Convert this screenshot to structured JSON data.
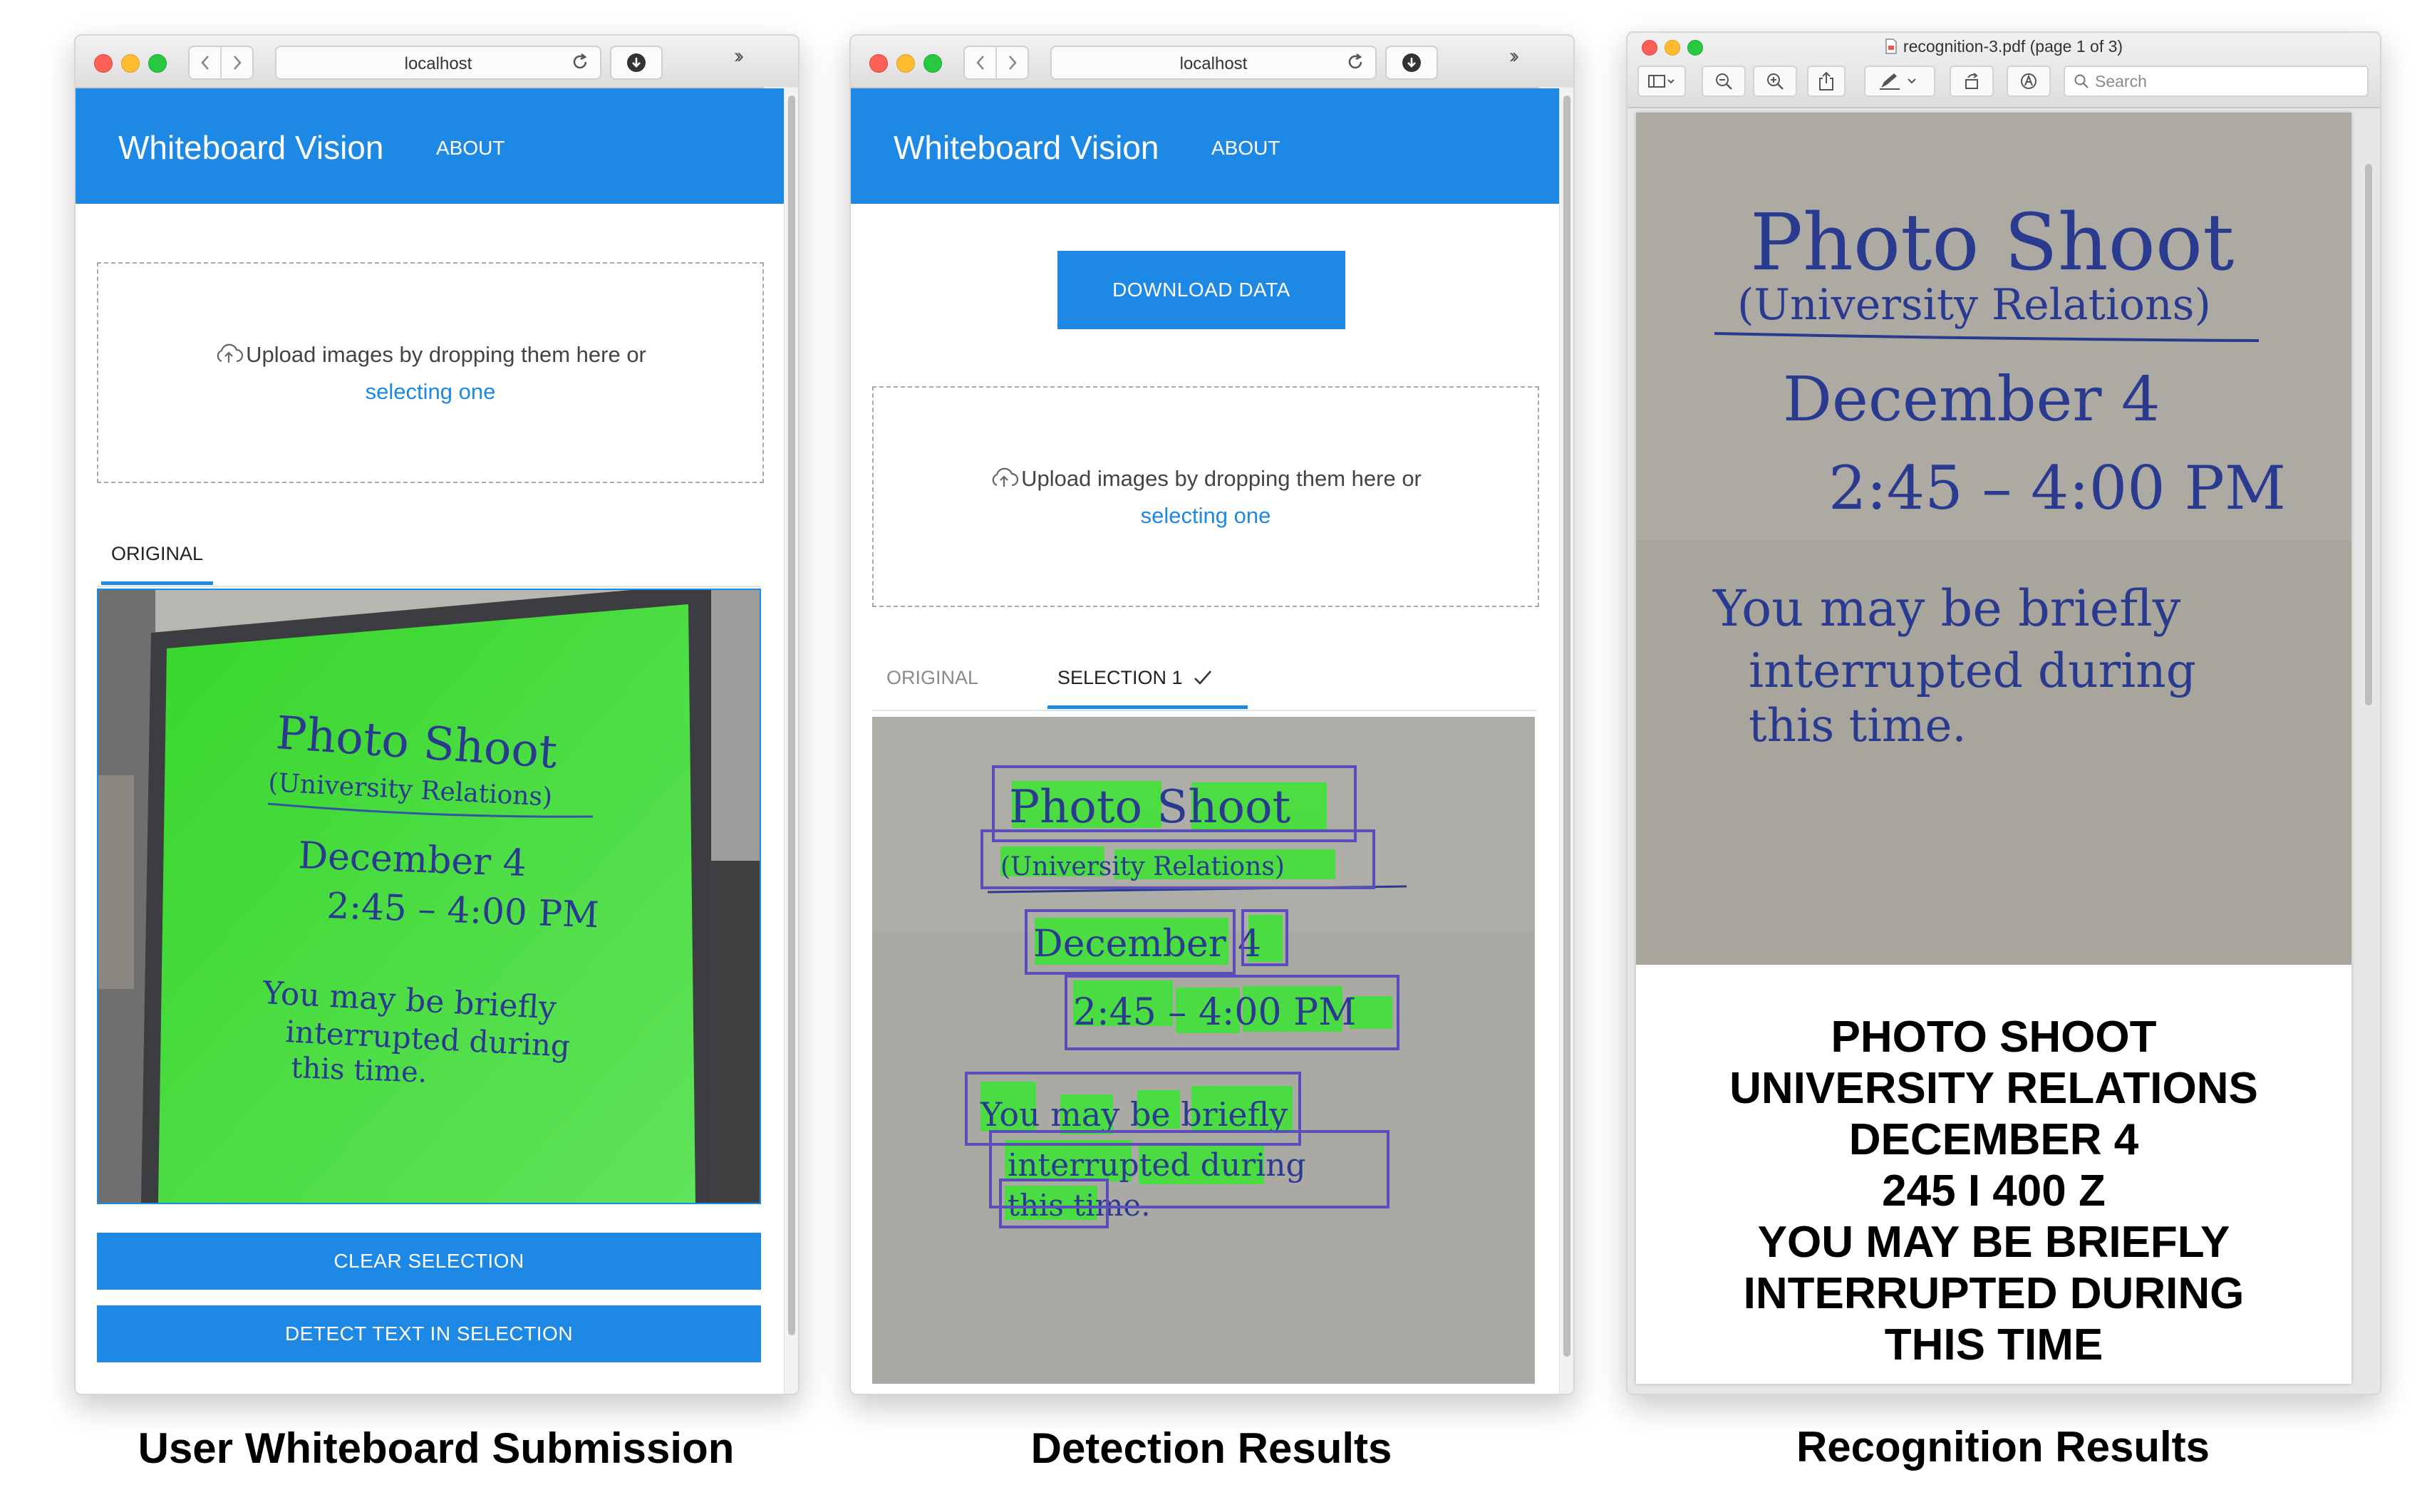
{
  "browser": {
    "url": "localhost"
  },
  "app": {
    "brand": "Whiteboard Vision",
    "about_label": "ABOUT"
  },
  "upload": {
    "prompt": "Upload images by dropping them here or",
    "link": "selecting one"
  },
  "panel1": {
    "tab_original": "ORIGINAL",
    "clear_label": "CLEAR SELECTION",
    "detect_label": "DETECT TEXT IN SELECTION",
    "caption": "User Whiteboard Submission"
  },
  "panel2": {
    "download_label": "DOWNLOAD DATA",
    "tab_original": "ORIGINAL",
    "tab_selection": "SELECTION 1",
    "caption": "Detection Results"
  },
  "panel3": {
    "file_title": "recognition-3.pdf (page 1 of 3)",
    "search_placeholder": "Search",
    "caption": "Recognition Results",
    "recognized_lines": [
      "PHOTO SHOOT",
      "UNIVERSITY RELATIONS",
      "DECEMBER 4",
      "245 I 400 Z",
      "YOU MAY BE BRIEFLY",
      "INTERRUPTED DURING",
      "THIS TIME"
    ]
  },
  "whiteboard": {
    "line1": "Photo Shoot",
    "line2": "(University Relations)",
    "line3": "December 4",
    "line4": "2:45 – 4:00 PM",
    "line5": "You may be briefly",
    "line6": "interrupted during",
    "line7": "this time."
  },
  "colors": {
    "accent": "#1e88e5",
    "highlight": "#44e03a",
    "box": "#5a4fb8",
    "ink": "#2a3a8e"
  }
}
